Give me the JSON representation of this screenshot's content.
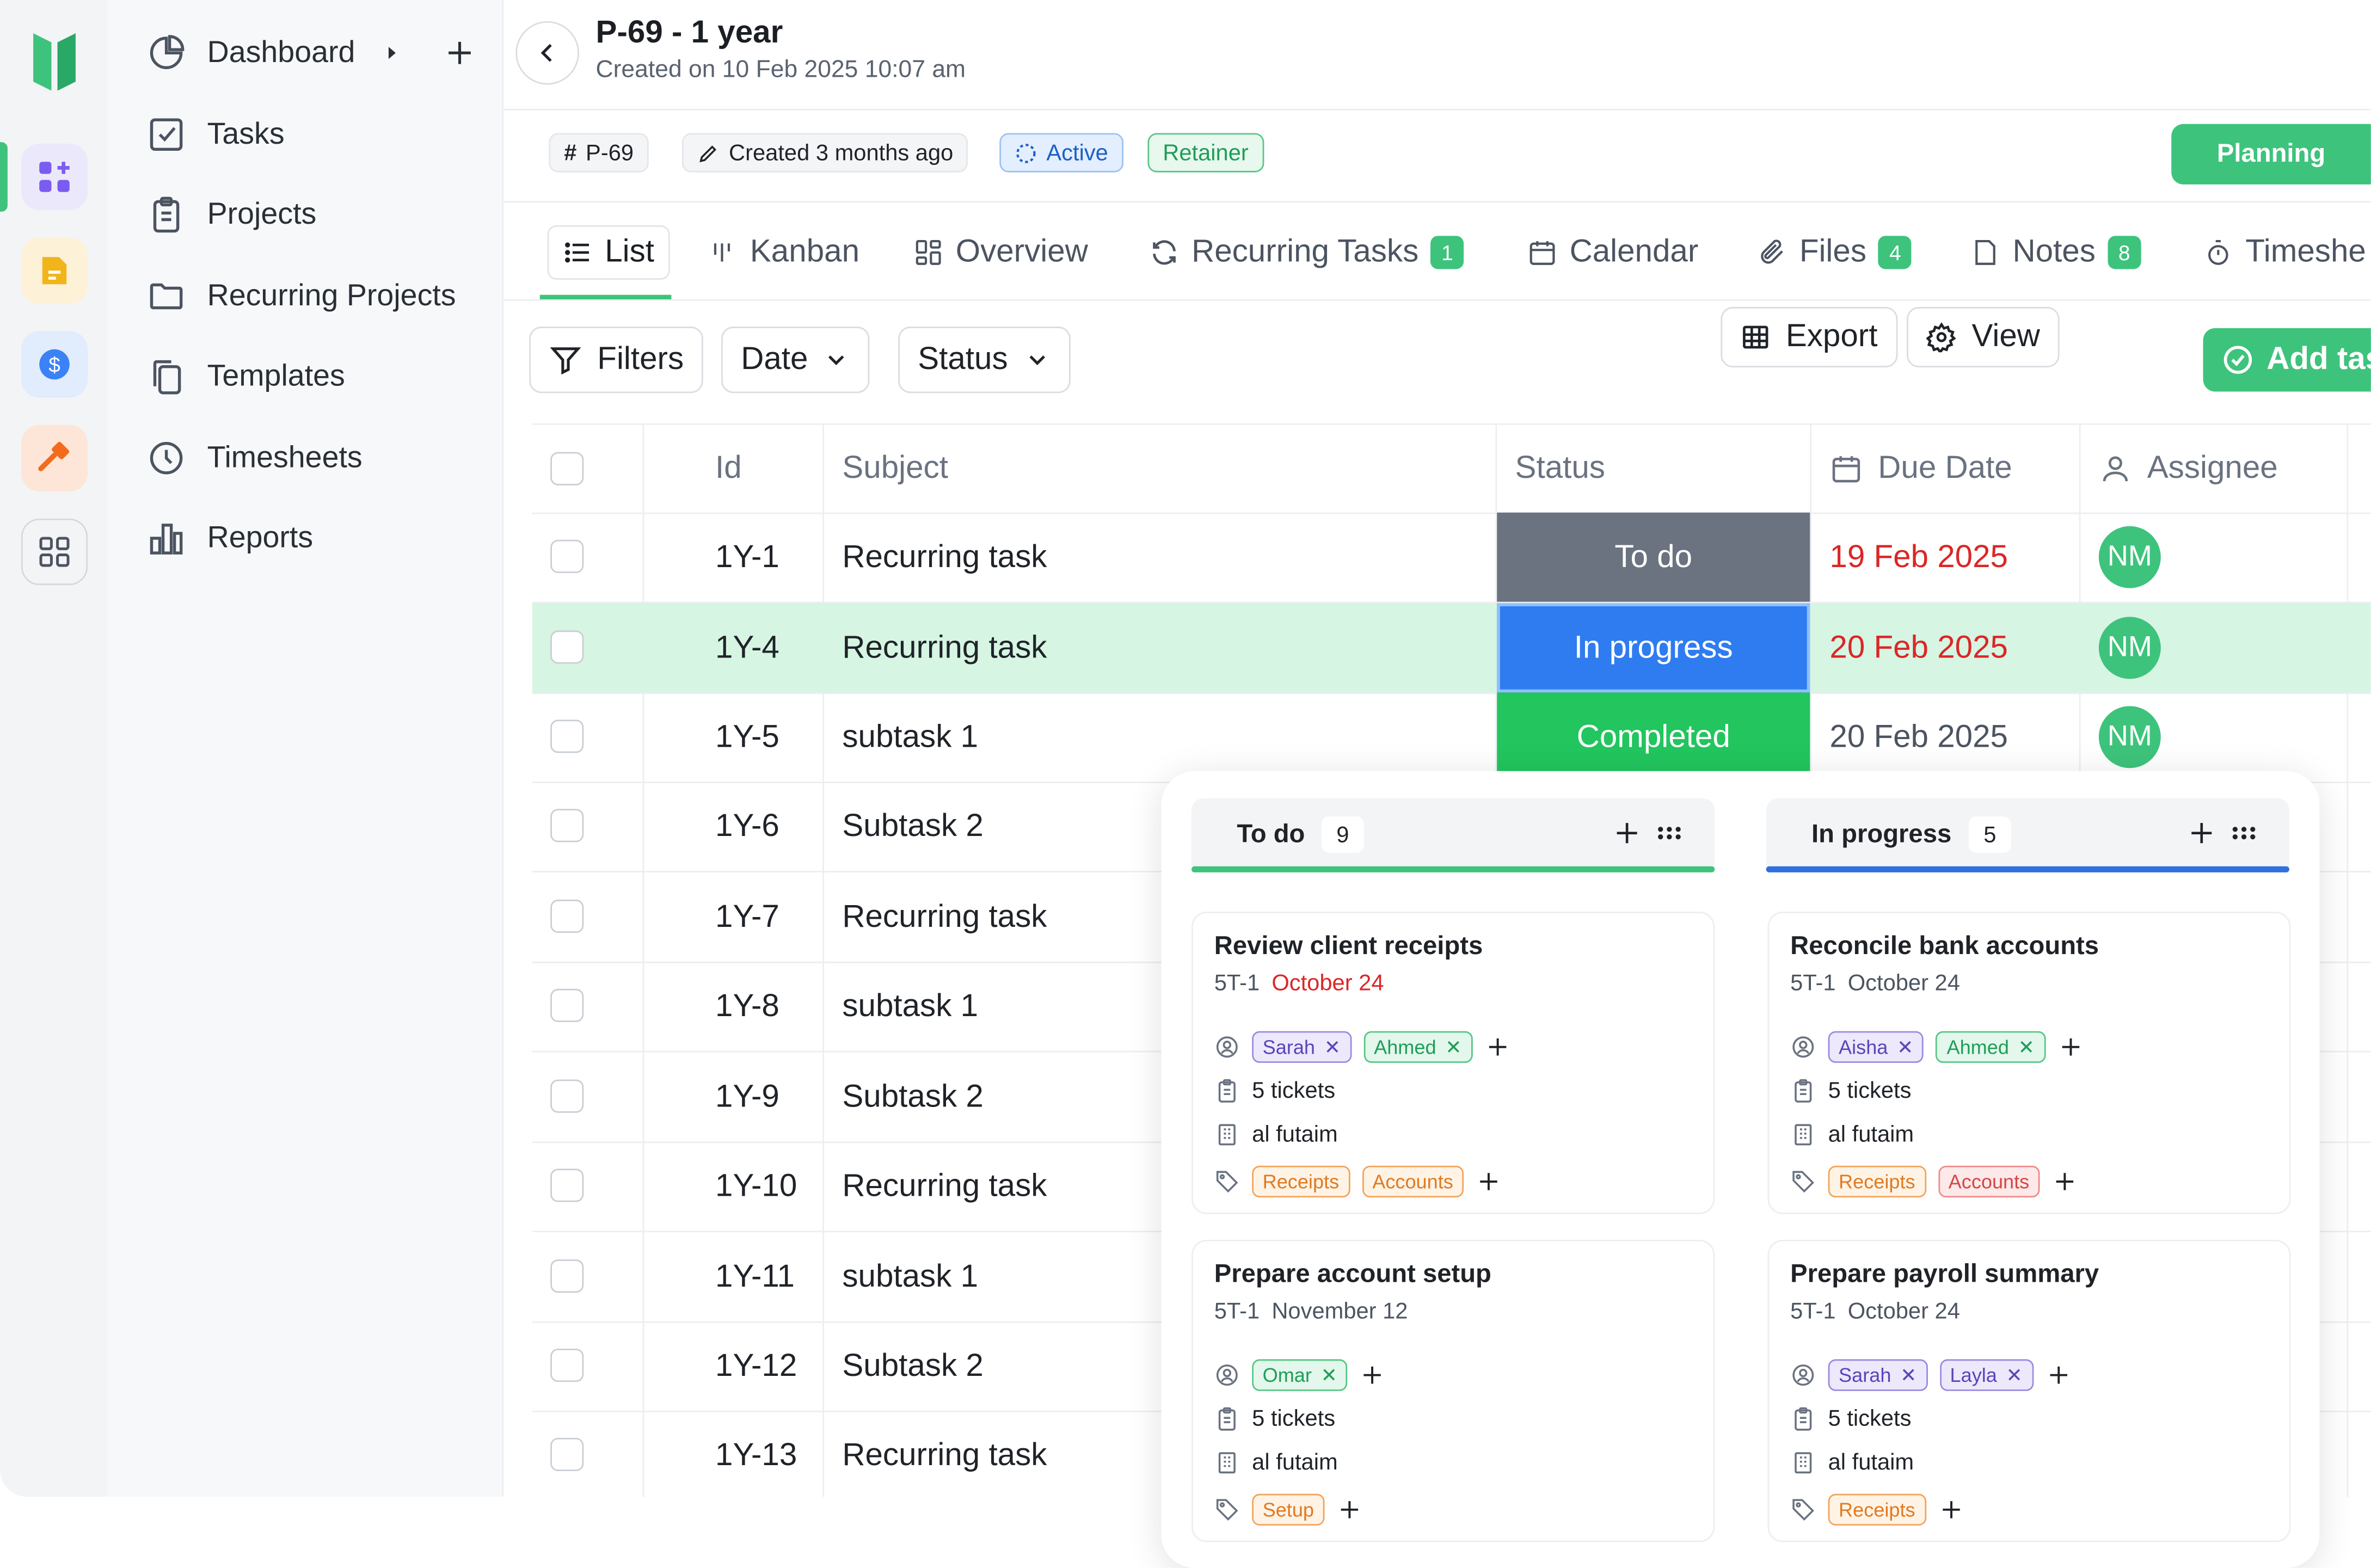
{
  "sidebar": {
    "items": [
      {
        "label": "Dashboard",
        "icon": "pie-chart-icon"
      },
      {
        "label": "Tasks",
        "icon": "checkbox-icon"
      },
      {
        "label": "Projects",
        "icon": "clipboard-icon"
      },
      {
        "label": "Recurring Projects",
        "icon": "folder-icon"
      },
      {
        "label": "Templates",
        "icon": "copy-icon"
      },
      {
        "label": "Timesheets",
        "icon": "clock-icon"
      },
      {
        "label": "Reports",
        "icon": "bar-chart-icon"
      }
    ]
  },
  "header": {
    "title": "P-69 - 1 year",
    "subtitle": "Created on 10 Feb 2025 10:07 am"
  },
  "meta": {
    "id_chip": "P-69",
    "created_chip": "Created 3 months ago",
    "status_chip": "Active",
    "type_chip": "Retainer",
    "stage": "Planning"
  },
  "tabs": [
    {
      "label": "List",
      "badge": null
    },
    {
      "label": "Kanban",
      "badge": null
    },
    {
      "label": "Overview",
      "badge": null
    },
    {
      "label": "Recurring Tasks",
      "badge": "1"
    },
    {
      "label": "Calendar",
      "badge": null
    },
    {
      "label": "Files",
      "badge": "4"
    },
    {
      "label": "Notes",
      "badge": "8"
    },
    {
      "label": "Timeshe",
      "badge": null
    }
  ],
  "toolbar": {
    "filters": "Filters",
    "date": "Date",
    "status": "Status",
    "export": "Export",
    "view": "View",
    "add_task": "Add tas"
  },
  "table": {
    "headers": {
      "id": "Id",
      "subject": "Subject",
      "status": "Status",
      "due": "Due Date",
      "assignee": "Assignee"
    },
    "rows": [
      {
        "id": "1Y-1",
        "subject": "Recurring task",
        "status": "To do",
        "due": "19 Feb 2025",
        "assignee": "NM"
      },
      {
        "id": "1Y-4",
        "subject": "Recurring task",
        "status": "In progress",
        "due": "20 Feb 2025",
        "assignee": "NM"
      },
      {
        "id": "1Y-5",
        "subject": "subtask 1",
        "status": "Completed",
        "due": "20 Feb 2025",
        "assignee": "NM"
      },
      {
        "id": "1Y-6",
        "subject": "Subtask 2"
      },
      {
        "id": "1Y-7",
        "subject": "Recurring task"
      },
      {
        "id": "1Y-8",
        "subject": "subtask 1"
      },
      {
        "id": "1Y-9",
        "subject": "Subtask 2"
      },
      {
        "id": "1Y-10",
        "subject": "Recurring task"
      },
      {
        "id": "1Y-11",
        "subject": "subtask 1"
      },
      {
        "id": "1Y-12",
        "subject": "Subtask 2"
      },
      {
        "id": "1Y-13",
        "subject": "Recurring task"
      }
    ]
  },
  "kanban": {
    "columns": [
      {
        "title": "To do",
        "count": "9",
        "cards": [
          {
            "title": "Review client receipts",
            "code": "5T-1",
            "date": "October 24",
            "people": [
              "Sarah",
              "Ahmed"
            ],
            "tickets": "5 tickets",
            "company": "al futaim",
            "tags": [
              "Receipts",
              "Accounts"
            ]
          },
          {
            "title": "Prepare account setup",
            "code": "5T-1",
            "date": "November 12",
            "people": [
              "Omar"
            ],
            "tickets": "5 tickets",
            "company": "al futaim",
            "tags": [
              "Setup"
            ]
          }
        ]
      },
      {
        "title": "In progress",
        "count": "5",
        "cards": [
          {
            "title": "Reconcile bank accounts",
            "code": "5T-1",
            "date": "October 24",
            "people": [
              "Aisha",
              "Ahmed"
            ],
            "tickets": "5 tickets",
            "company": "al futaim",
            "tags": [
              "Receipts",
              "Accounts"
            ]
          },
          {
            "title": "Prepare payroll summary",
            "code": "5T-1",
            "date": "October 24",
            "people": [
              "Sarah",
              "Layla"
            ],
            "tickets": "5 tickets",
            "company": "al futaim",
            "tags": [
              "Receipts"
            ]
          }
        ]
      }
    ]
  },
  "colors": {
    "accent": "#3ec37c",
    "todo": "#6b7280",
    "in_progress": "#2f7cf0",
    "completed": "#22c55e",
    "overdue": "#dc2626"
  }
}
